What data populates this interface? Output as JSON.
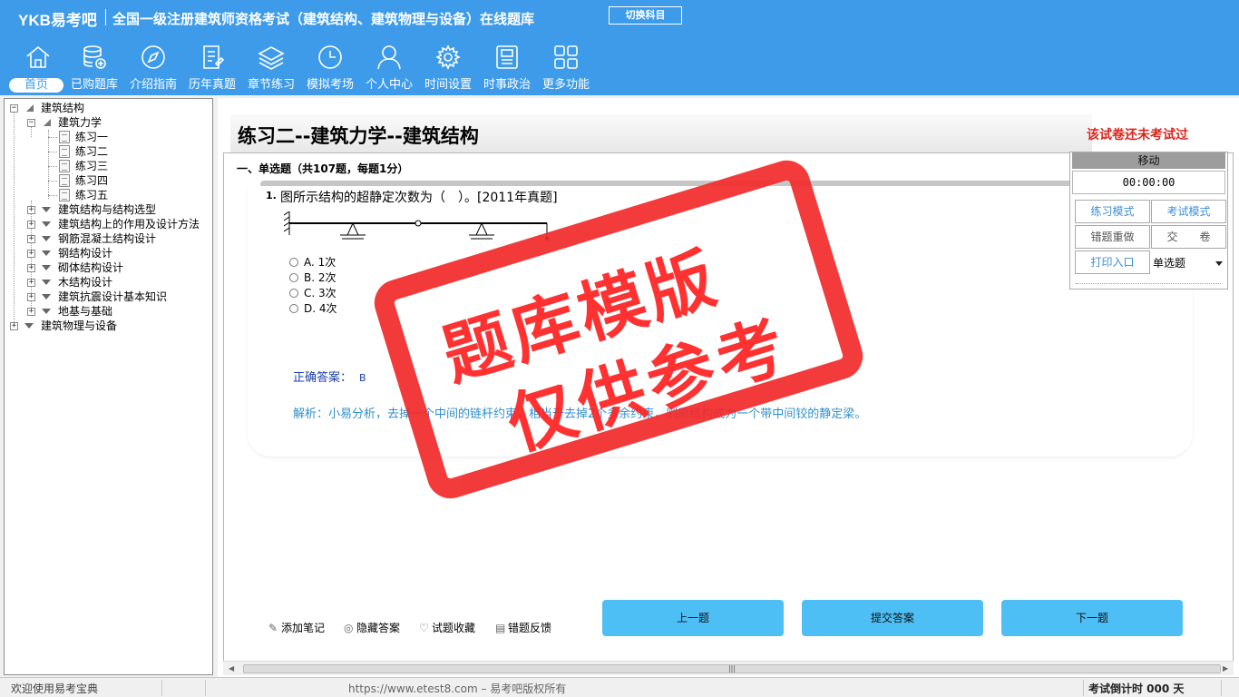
{
  "header": {
    "logo": "YKB易考吧",
    "title": "全国一级注册建筑师资格考试（建筑结构、建筑物理与设备）在线题库",
    "switch_label": "切换科目",
    "nav": [
      {
        "label": "首页",
        "icon": "home-icon"
      },
      {
        "label": "已购题库",
        "icon": "database-icon"
      },
      {
        "label": "介绍指南",
        "icon": "compass-icon"
      },
      {
        "label": "历年真题",
        "icon": "document-list-icon"
      },
      {
        "label": "章节练习",
        "icon": "layers-icon"
      },
      {
        "label": "模拟考场",
        "icon": "clock-icon"
      },
      {
        "label": "个人中心",
        "icon": "user-icon"
      },
      {
        "label": "时间设置",
        "icon": "gear-icon"
      },
      {
        "label": "时事政治",
        "icon": "news-icon"
      },
      {
        "label": "更多功能",
        "icon": "grid-icon"
      }
    ]
  },
  "tree": {
    "root1": "建筑结构",
    "child1": "建筑力学",
    "leaves": [
      "练习一",
      "练习二",
      "练习三",
      "练习四",
      "练习五"
    ],
    "siblings": [
      "建筑结构与结构选型",
      "建筑结构上的作用及设计方法",
      "钢筋混凝土结构设计",
      "钢结构设计",
      "砌体结构设计",
      "木结构设计",
      "建筑抗震设计基本知识",
      "地基与基础"
    ],
    "root2": "建筑物理与设备"
  },
  "exam": {
    "title": "练习二--建筑力学--建筑结构",
    "status": "该试卷还未考试过",
    "section": "一、单选题（共107题，每题1分）",
    "question": {
      "number": "1.",
      "text": "图所示结构的超静定次数为（　）。[2011年真题]",
      "options": [
        "A. 1次",
        "B. 2次",
        "C. 3次",
        "D. 4次"
      ],
      "answer_label": "正确答案：",
      "answer_value": "B",
      "analysis": "解析：小易分析，去掉一个中间的链杆约束，相当于去掉2个多余约束，则原结构成为一个带中间铰的静定梁。"
    },
    "tools": [
      "添加笔记",
      "隐藏答案",
      "试题收藏",
      "错题反馈"
    ],
    "buttons": {
      "prev": "上一题",
      "submit": "提交答案",
      "next": "下一题"
    }
  },
  "panel": {
    "move": "移动",
    "timer": "00:00:00",
    "practice_mode": "练习模式",
    "exam_mode": "考试模式",
    "redo_wrong": "错题重做",
    "hand_in": "交　　卷",
    "print": "打印入口",
    "type_select": "单选题"
  },
  "status": {
    "welcome": "欢迎使用易考宝典",
    "url": "https://www.etest8.com – 易考吧版权所有",
    "countdown": "考试倒计时 000 天"
  },
  "watermark": {
    "line1": "题库模版",
    "line2": "仅供参考"
  },
  "colors": {
    "header_blue": "#3d9be9",
    "button_blue": "#4dbff5",
    "status_red": "#d9261c",
    "stamp_red": "#f22a2a"
  }
}
